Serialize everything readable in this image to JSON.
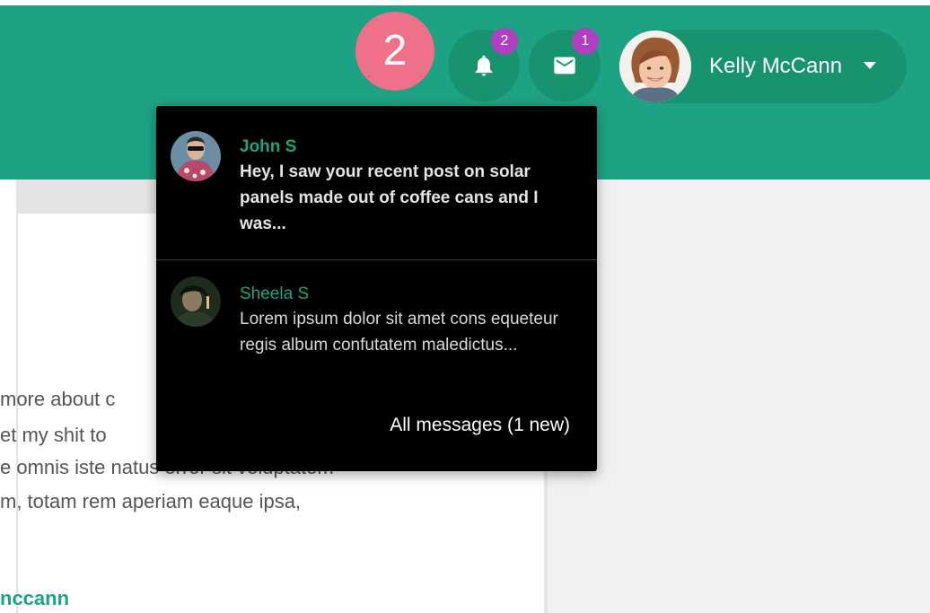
{
  "header": {
    "step_number": "2",
    "notifications_count": "2",
    "messages_count": "1",
    "user_name": "Kelly McCann",
    "icons": [
      "bell-icon",
      "mail-icon",
      "caret-down-icon"
    ]
  },
  "background_content": {
    "lines": [
      "more about c",
      "et my shit to",
      "e omnis iste natus error sit voluptatem",
      "m, totam rem aperiam eaque ipsa,"
    ],
    "author_link": "nccann"
  },
  "messages_dropdown": {
    "messages": [
      {
        "sender": "John S",
        "snippet": "Hey, I saw your recent post on solar panels made out of coffee cans and I was...",
        "unread": true
      },
      {
        "sender": "Sheela S",
        "snippet": "Lorem ipsum dolor sit amet cons equeteur regis album confutatem maledictus...",
        "unread": false
      }
    ],
    "all_messages_label": "All messages (1 new)"
  },
  "colors": {
    "header": "#1da283",
    "header_button": "#18936f",
    "step_badge": "#ef7089",
    "count_badge": "#b13fc2",
    "dropdown_bg": "#000000",
    "sender_name": "#1da283"
  }
}
